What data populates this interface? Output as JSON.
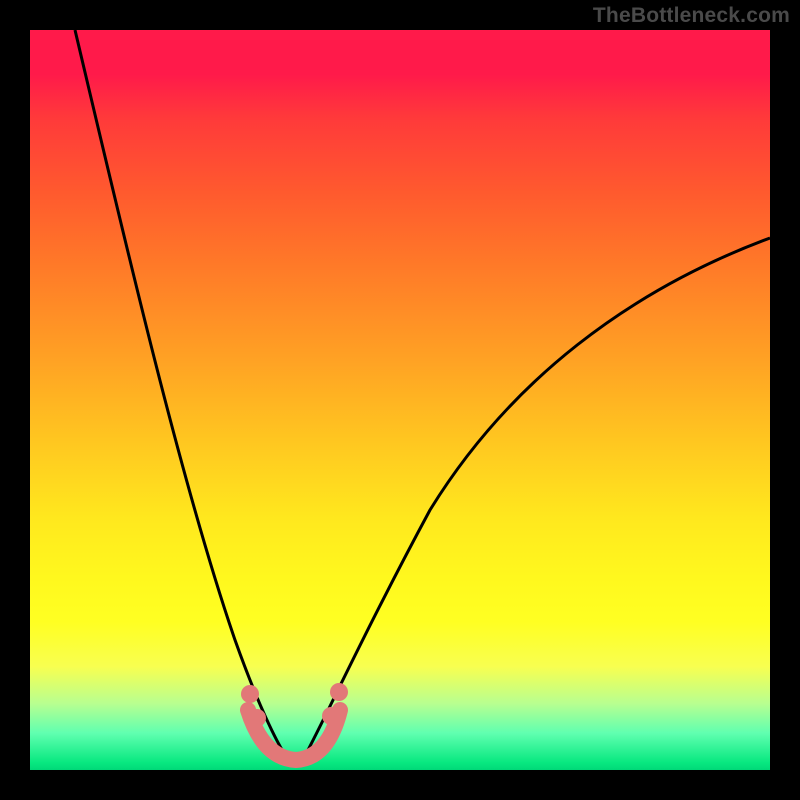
{
  "watermark": "TheBottleneck.com",
  "chart_data": {
    "type": "line",
    "title": "",
    "xlabel": "",
    "ylabel": "",
    "xlim": [
      0,
      100
    ],
    "ylim": [
      0,
      100
    ],
    "series": [
      {
        "name": "left-curve",
        "x": [
          6,
          10,
          14,
          18,
          22,
          26,
          29,
          31,
          33,
          35
        ],
        "y": [
          100,
          84,
          68,
          52,
          37,
          23,
          12,
          6,
          2,
          0
        ]
      },
      {
        "name": "right-curve",
        "x": [
          37,
          40,
          45,
          52,
          60,
          70,
          82,
          94,
          100
        ],
        "y": [
          0,
          4,
          14,
          30,
          44,
          56,
          65,
          70,
          72
        ]
      }
    ],
    "highlight_band": {
      "name": "bottom-pink-band",
      "x": [
        29,
        31,
        33,
        35,
        37,
        39,
        41
      ],
      "y": [
        10,
        4,
        1,
        0,
        1,
        4,
        10
      ]
    },
    "highlight_dots": {
      "name": "pink-dots",
      "points": [
        {
          "x": 29.5,
          "y": 11
        },
        {
          "x": 30.5,
          "y": 7
        },
        {
          "x": 40.5,
          "y": 8
        },
        {
          "x": 41.5,
          "y": 12
        }
      ]
    },
    "gradient_stops": [
      {
        "pos": 0,
        "color": "#ff1a4a"
      },
      {
        "pos": 50,
        "color": "#ffc820"
      },
      {
        "pos": 80,
        "color": "#ffff22"
      },
      {
        "pos": 100,
        "color": "#00d878"
      }
    ]
  }
}
